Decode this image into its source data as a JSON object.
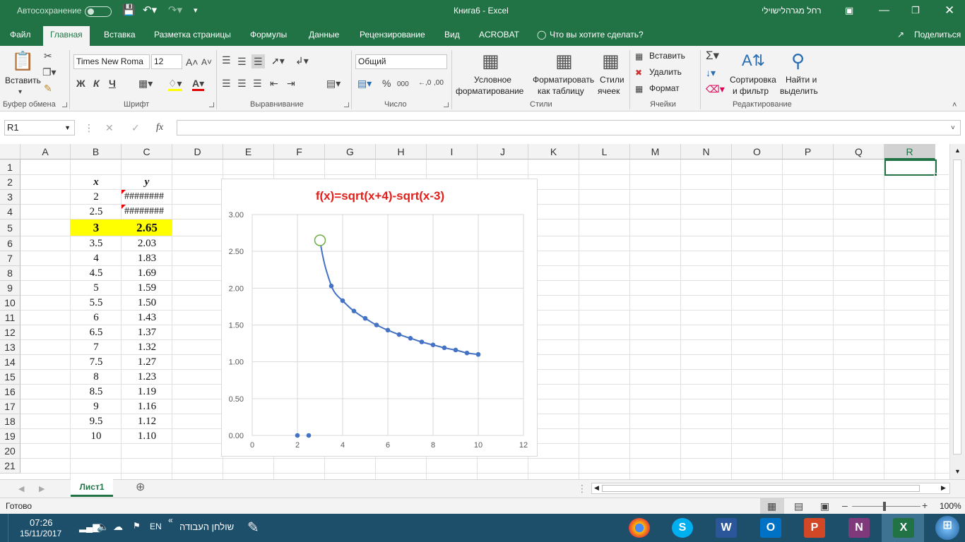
{
  "titlebar": {
    "autosave_label": "Автосохранение",
    "title": "Книга6  -  Excel",
    "user": "רחל מגרהלישוילי"
  },
  "tabs": [
    "Файл",
    "Главная",
    "Вставка",
    "Разметка страницы",
    "Формулы",
    "Данные",
    "Рецензирование",
    "Вид",
    "ACROBAT"
  ],
  "tell_me": "Что вы хотите сделать?",
  "share": "Поделиться",
  "ribbon": {
    "paste": "Вставить",
    "font_name": "Times New Roma",
    "font_size": "12",
    "bold": "Ж",
    "italic": "К",
    "underline": "Ч",
    "number_format": "Общий",
    "cond_format_1": "Условное",
    "cond_format_2": "форматирование",
    "format_table_1": "Форматировать",
    "format_table_2": "как таблицу",
    "cell_styles_1": "Стили",
    "cell_styles_2": "ячеек",
    "insert": "Вставить",
    "delete": "Удалить",
    "format": "Формат",
    "sort_1": "Сортировка",
    "sort_2": "и фильтр",
    "find_1": "Найти и",
    "find_2": "выделить",
    "groups": {
      "clipboard": "Буфер обмена",
      "font": "Шрифт",
      "align": "Выравнивание",
      "number": "Число",
      "styles": "Стили",
      "cells": "Ячейки",
      "editing": "Редактирование"
    }
  },
  "formula": {
    "namebox": "R1",
    "fx": "fx",
    "value": ""
  },
  "columns": [
    "A",
    "B",
    "C",
    "D",
    "E",
    "F",
    "G",
    "H",
    "I",
    "J",
    "K",
    "L",
    "M",
    "N",
    "O",
    "P",
    "Q",
    "R"
  ],
  "rows": [
    "1",
    "2",
    "3",
    "4",
    "5",
    "6",
    "7",
    "8",
    "9",
    "10",
    "11",
    "12",
    "13",
    "14",
    "15",
    "16",
    "17",
    "18",
    "19",
    "20",
    "21"
  ],
  "table": {
    "header_x": "x",
    "header_y": "y",
    "x": [
      "2",
      "2.5",
      "3",
      "3.5",
      "4",
      "4.5",
      "5",
      "5.5",
      "6",
      "6.5",
      "7",
      "7.5",
      "8",
      "8.5",
      "9",
      "9.5",
      "10"
    ],
    "y": [
      "########",
      "########",
      "2.65",
      "2.03",
      "1.83",
      "1.69",
      "1.59",
      "1.50",
      "1.43",
      "1.37",
      "1.32",
      "1.27",
      "1.23",
      "1.19",
      "1.16",
      "1.12",
      "1.10"
    ],
    "highlight_color": "#ffff00"
  },
  "chart_data": {
    "type": "scatter",
    "title": "f(x)=sqrt(x+4)-sqrt(x-3)",
    "title_color": "#e0201b",
    "series_color": "#4472c4",
    "xlim": [
      0,
      12
    ],
    "ylim": [
      0,
      3
    ],
    "x_ticks": [
      "0",
      "2",
      "4",
      "6",
      "8",
      "10",
      "12"
    ],
    "y_ticks": [
      "0.00",
      "0.50",
      "1.00",
      "1.50",
      "2.00",
      "2.50",
      "3.00"
    ],
    "grid": true,
    "points": [
      [
        2,
        0
      ],
      [
        2.5,
        0
      ],
      [
        3,
        2.65
      ],
      [
        3.5,
        2.03
      ],
      [
        4,
        1.83
      ],
      [
        4.5,
        1.69
      ],
      [
        5,
        1.59
      ],
      [
        5.5,
        1.5
      ],
      [
        6,
        1.43
      ],
      [
        6.5,
        1.37
      ],
      [
        7,
        1.32
      ],
      [
        7.5,
        1.27
      ],
      [
        8,
        1.23
      ],
      [
        8.5,
        1.19
      ],
      [
        9,
        1.16
      ],
      [
        9.5,
        1.12
      ],
      [
        10,
        1.1
      ]
    ],
    "highlighted_point": [
      3,
      2.65
    ]
  },
  "sheet_tab": "Лист1",
  "status": {
    "ready": "Готово",
    "zoom": "100%"
  },
  "taskbar": {
    "time": "07:26",
    "date": "15/11/2017",
    "lang": "EN",
    "desk": "שולחן העבודה"
  }
}
